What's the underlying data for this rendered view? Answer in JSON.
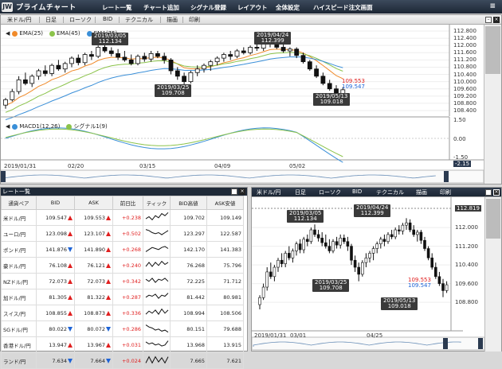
{
  "app": {
    "logo_mark": "JW",
    "title": "プライムチャート",
    "menu": [
      "レート一覧",
      "チャート追加",
      "シグナル登録",
      "レイアウト",
      "全体設定",
      "ハイスピード注文画面"
    ],
    "hamburger": "≡"
  },
  "chart_main": {
    "toolbar": [
      "米ドル/円",
      "日足",
      "ローソク",
      "BID",
      "テクニカル",
      "描画",
      "印刷"
    ],
    "legend": [
      {
        "name": "EMA(25)",
        "color": "#f08a2a"
      },
      {
        "name": "EMA(45)",
        "color": "#8bc34a"
      },
      {
        "name": "EMA(75)",
        "color": "#3a8fd8"
      }
    ],
    "price_axis": [
      "112.800",
      "112.400",
      "112.000",
      "111.600",
      "111.200",
      "110.800",
      "110.400",
      "110.000",
      "109.600",
      "109.200",
      "108.800",
      "108.400"
    ],
    "bid_label": "109.553",
    "ask_label": "109.547",
    "callouts": [
      {
        "date": "2019/03/05",
        "price": "112.134"
      },
      {
        "date": "2019/04/24",
        "price": "112.399"
      },
      {
        "date": "2019/03/25",
        "price": "109.708"
      },
      {
        "date": "2019/05/13",
        "price": "109.018"
      }
    ],
    "macd_legend": [
      {
        "name": "MACD1(12,26)",
        "color": "#3a8fd8"
      },
      {
        "name": "シグナル1(9)",
        "color": "#8bc34a"
      }
    ],
    "macd_axis": [
      "1.50",
      "0.00",
      "-1.50"
    ],
    "macd_value": "-2.15",
    "date_axis": [
      "2019/01/31",
      "02/20",
      "03/15",
      "04/09",
      "05/02"
    ],
    "series": [
      {
        "o": 108.7,
        "h": 109.1,
        "l": 108.5,
        "c": 109.0
      },
      {
        "o": 109.0,
        "h": 109.6,
        "l": 108.9,
        "c": 109.45
      },
      {
        "o": 109.45,
        "h": 110.3,
        "l": 109.3,
        "c": 110.1
      },
      {
        "o": 110.1,
        "h": 110.5,
        "l": 109.8,
        "c": 109.9
      },
      {
        "o": 109.9,
        "h": 110.4,
        "l": 109.7,
        "c": 110.3
      },
      {
        "o": 110.3,
        "h": 110.7,
        "l": 110.1,
        "c": 110.6
      },
      {
        "o": 110.6,
        "h": 110.9,
        "l": 110.3,
        "c": 110.45
      },
      {
        "o": 110.45,
        "h": 111.0,
        "l": 110.3,
        "c": 110.9
      },
      {
        "o": 110.9,
        "h": 111.2,
        "l": 110.6,
        "c": 110.7
      },
      {
        "o": 110.7,
        "h": 111.1,
        "l": 110.5,
        "c": 111.0
      },
      {
        "o": 111.0,
        "h": 111.4,
        "l": 110.8,
        "c": 111.3
      },
      {
        "o": 111.3,
        "h": 111.5,
        "l": 110.9,
        "c": 111.05
      },
      {
        "o": 111.05,
        "h": 111.6,
        "l": 110.9,
        "c": 111.5
      },
      {
        "o": 111.5,
        "h": 111.7,
        "l": 111.2,
        "c": 111.4
      },
      {
        "o": 111.4,
        "h": 112.0,
        "l": 111.3,
        "c": 111.9
      },
      {
        "o": 111.9,
        "h": 112.13,
        "l": 111.6,
        "c": 111.7
      },
      {
        "o": 111.7,
        "h": 111.9,
        "l": 111.4,
        "c": 111.55
      },
      {
        "o": 111.55,
        "h": 111.8,
        "l": 111.2,
        "c": 111.35
      },
      {
        "o": 111.35,
        "h": 111.7,
        "l": 111.1,
        "c": 111.2
      },
      {
        "o": 111.2,
        "h": 111.5,
        "l": 110.9,
        "c": 111.0
      },
      {
        "o": 111.0,
        "h": 111.5,
        "l": 110.9,
        "c": 111.4
      },
      {
        "o": 111.4,
        "h": 111.6,
        "l": 111.1,
        "c": 111.25
      },
      {
        "o": 111.25,
        "h": 111.7,
        "l": 111.1,
        "c": 111.55
      },
      {
        "o": 111.55,
        "h": 111.7,
        "l": 111.3,
        "c": 111.4
      },
      {
        "o": 111.4,
        "h": 111.6,
        "l": 111.0,
        "c": 111.2
      },
      {
        "o": 111.2,
        "h": 111.3,
        "l": 110.4,
        "c": 110.6
      },
      {
        "o": 110.6,
        "h": 110.8,
        "l": 110.1,
        "c": 110.3
      },
      {
        "o": 110.3,
        "h": 110.5,
        "l": 109.7,
        "c": 110.0
      },
      {
        "o": 110.0,
        "h": 110.6,
        "l": 109.9,
        "c": 110.5
      },
      {
        "o": 110.5,
        "h": 110.9,
        "l": 110.3,
        "c": 110.7
      },
      {
        "o": 110.7,
        "h": 111.0,
        "l": 110.5,
        "c": 110.9
      },
      {
        "o": 110.9,
        "h": 111.2,
        "l": 110.6,
        "c": 111.1
      },
      {
        "o": 111.1,
        "h": 111.4,
        "l": 110.9,
        "c": 111.3
      },
      {
        "o": 111.3,
        "h": 111.6,
        "l": 111.1,
        "c": 111.5
      },
      {
        "o": 111.5,
        "h": 111.7,
        "l": 111.2,
        "c": 111.4
      },
      {
        "o": 111.4,
        "h": 111.8,
        "l": 111.3,
        "c": 111.7
      },
      {
        "o": 111.7,
        "h": 111.9,
        "l": 111.5,
        "c": 111.6
      },
      {
        "o": 111.6,
        "h": 112.0,
        "l": 111.5,
        "c": 111.9
      },
      {
        "o": 111.9,
        "h": 112.1,
        "l": 111.7,
        "c": 111.85
      },
      {
        "o": 111.85,
        "h": 112.2,
        "l": 111.7,
        "c": 112.1
      },
      {
        "o": 112.1,
        "h": 112.4,
        "l": 111.9,
        "c": 112.2
      },
      {
        "o": 112.2,
        "h": 112.35,
        "l": 111.8,
        "c": 111.9
      },
      {
        "o": 111.9,
        "h": 112.1,
        "l": 111.6,
        "c": 111.7
      },
      {
        "o": 111.7,
        "h": 111.9,
        "l": 111.4,
        "c": 111.8
      },
      {
        "o": 111.8,
        "h": 111.9,
        "l": 111.3,
        "c": 111.45
      },
      {
        "o": 111.45,
        "h": 111.6,
        "l": 111.0,
        "c": 111.1
      },
      {
        "o": 111.1,
        "h": 111.2,
        "l": 110.6,
        "c": 110.7
      },
      {
        "o": 110.7,
        "h": 110.9,
        "l": 110.2,
        "c": 110.3
      },
      {
        "o": 110.3,
        "h": 110.5,
        "l": 109.8,
        "c": 109.9
      },
      {
        "o": 109.9,
        "h": 110.1,
        "l": 109.5,
        "c": 109.6
      },
      {
        "o": 109.6,
        "h": 109.8,
        "l": 109.02,
        "c": 109.3
      },
      {
        "o": 109.3,
        "h": 109.7,
        "l": 109.2,
        "c": 109.55
      }
    ]
  },
  "rate_list": {
    "title": "レート一覧",
    "columns": [
      "通貨ペア",
      "BID",
      "ASK",
      "前日比",
      "ティック",
      "BID高値",
      "ASK安値"
    ],
    "rows": [
      {
        "pair": "米ドル/円",
        "bid": "109.547",
        "bid_dir": "up",
        "ask": "109.553",
        "ask_dir": "up",
        "chg": "+0.238",
        "high": "109.702",
        "low": "109.149",
        "tick": [
          3,
          5,
          2,
          6,
          4,
          8,
          6,
          9
        ]
      },
      {
        "pair": "ユーロ/円",
        "bid": "123.098",
        "bid_dir": "up",
        "ask": "123.107",
        "ask_dir": "up",
        "chg": "+0.502",
        "high": "123.297",
        "low": "122.587",
        "tick": [
          8,
          7,
          5,
          4,
          5,
          3,
          5,
          7
        ]
      },
      {
        "pair": "ポンド/円",
        "bid": "141.876",
        "bid_dir": "dn",
        "ask": "141.890",
        "ask_dir": "up",
        "chg": "+0.268",
        "high": "142.170",
        "low": "141.383",
        "tick": [
          2,
          4,
          6,
          5,
          4,
          6,
          7,
          5
        ]
      },
      {
        "pair": "豪ドル/円",
        "bid": "76.108",
        "bid_dir": "up",
        "ask": "76.121",
        "ask_dir": "up",
        "chg": "+0.240",
        "high": "76.268",
        "low": "75.796",
        "tick": [
          3,
          7,
          3,
          7,
          4,
          8,
          5,
          7
        ]
      },
      {
        "pair": "NZドル/円",
        "bid": "72.073",
        "bid_dir": "up",
        "ask": "72.073",
        "ask_dir": "up",
        "chg": "+0.342",
        "high": "72.225",
        "low": "71.712",
        "tick": [
          6,
          4,
          7,
          3,
          6,
          5,
          7,
          4
        ]
      },
      {
        "pair": "加ドル/円",
        "bid": "81.305",
        "bid_dir": "up",
        "ask": "81.322",
        "ask_dir": "up",
        "chg": "+0.287",
        "high": "81.442",
        "low": "80.981",
        "tick": [
          4,
          6,
          5,
          7,
          3,
          6,
          5,
          8
        ]
      },
      {
        "pair": "スイス/円",
        "bid": "108.855",
        "bid_dir": "up",
        "ask": "108.873",
        "ask_dir": "up",
        "chg": "+0.336",
        "high": "108.994",
        "low": "108.506",
        "tick": [
          3,
          6,
          4,
          7,
          3,
          8,
          4,
          7
        ]
      },
      {
        "pair": "SGドル/円",
        "bid": "80.022",
        "bid_dir": "dn",
        "ask": "80.072",
        "ask_dir": "dn",
        "chg": "+0.286",
        "high": "80.151",
        "low": "79.688",
        "tick": [
          8,
          6,
          5,
          3,
          4,
          2,
          3,
          1
        ]
      },
      {
        "pair": "香港ドル/円",
        "bid": "13.947",
        "bid_dir": "up",
        "ask": "13.967",
        "ask_dir": "up",
        "chg": "+0.031",
        "high": "13.968",
        "low": "13.915",
        "tick": [
          7,
          5,
          6,
          4,
          5,
          3,
          4,
          8
        ]
      },
      {
        "pair": "ランド/円",
        "bid": "7.634",
        "bid_dir": "dn",
        "ask": "7.664",
        "ask_dir": "dn",
        "chg": "+0.024",
        "high": "7.665",
        "low": "7.621",
        "tick": [
          2,
          8,
          2,
          8,
          3,
          7,
          2,
          8
        ]
      }
    ]
  },
  "chart_small": {
    "toolbar": [
      "米ドル/円",
      "日足",
      "ローソク",
      "BID",
      "テクニカル",
      "描画",
      "印刷"
    ],
    "price_axis": [
      "112.819",
      "112.000",
      "111.200",
      "110.400",
      "109.600",
      "108.800"
    ],
    "bid_label": "109.553",
    "ask_label": "109.547",
    "callouts": [
      {
        "date": "2019/03/05",
        "price": "112.134"
      },
      {
        "date": "2019/04/24",
        "price": "112.399"
      },
      {
        "date": "2019/03/25",
        "price": "109.708"
      },
      {
        "date": "2019/05/13",
        "price": "109.018"
      }
    ],
    "date_axis": [
      "2019/01/31",
      "03/01",
      "04/25"
    ]
  }
}
